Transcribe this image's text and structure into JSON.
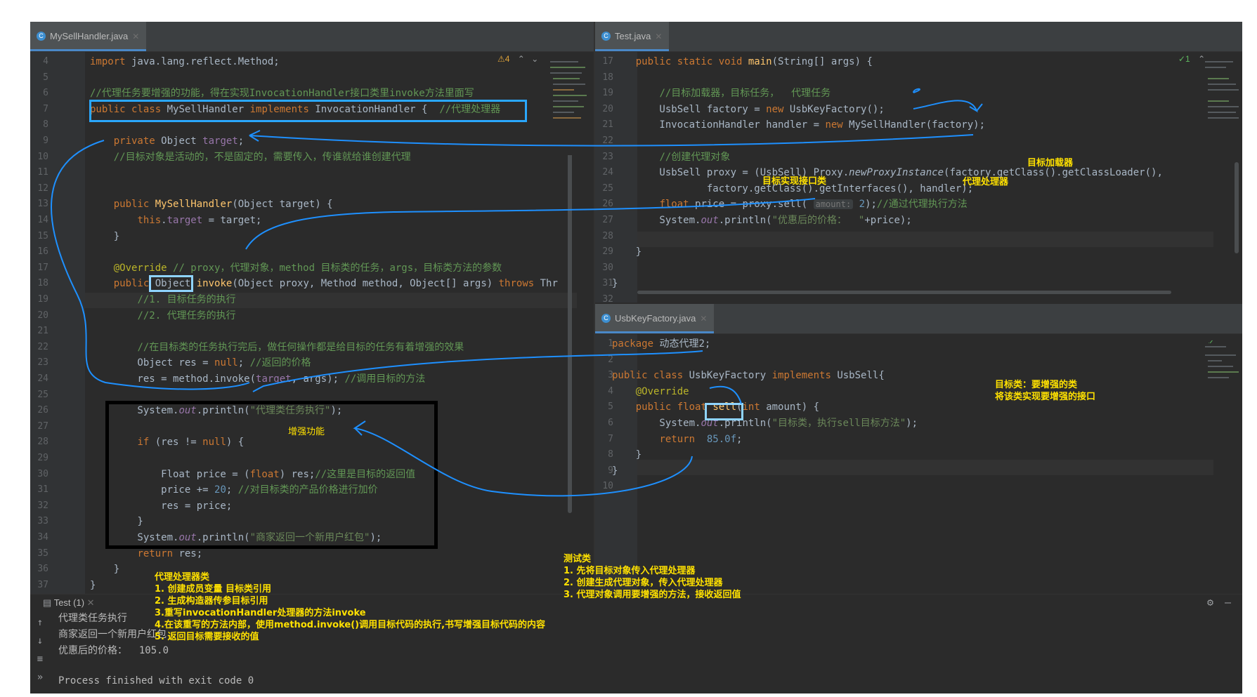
{
  "left_editor": {
    "tab_title": "MySellHandler.java",
    "inspection_badge": "⚠4",
    "lines": [
      {
        "n": "4",
        "html": "<span class=\"kw\">import</span> java.lang.reflect.Method;"
      },
      {
        "n": "5",
        "html": ""
      },
      {
        "n": "6",
        "html": "<span class=\"cm\">//代理任务要增强的功能，得在实现InvocationHandler接口类里invoke方法里面写</span>"
      },
      {
        "n": "7",
        "html": "<span class=\"kw\">public class</span> MySellHandler <span class=\"kw\">implements</span> InvocationHandler {  <span class=\"cm\">//代理处理器</span>"
      },
      {
        "n": "8",
        "html": ""
      },
      {
        "n": "9",
        "html": "    <span class=\"kw\">private</span> Object <span class=\"fld\">target</span>;"
      },
      {
        "n": "10",
        "html": "    <span class=\"cm\">//目标对象是活动的，不是固定的，需要传入，传谁就给谁创建代理</span>"
      },
      {
        "n": "11",
        "html": ""
      },
      {
        "n": "12",
        "html": ""
      },
      {
        "n": "13",
        "html": "    <span class=\"kw\">public</span> <span class=\"fn\">MySellHandler</span>(Object target) {"
      },
      {
        "n": "14",
        "html": "        <span class=\"kw\">this</span>.<span class=\"fld\">target</span> = target;"
      },
      {
        "n": "15",
        "html": "    }"
      },
      {
        "n": "16",
        "html": ""
      },
      {
        "n": "17",
        "html": "    <span class=\"ann\">@Override</span> <span class=\"cm\">// proxy，代理对象，method 目标类的任务，args，目标类方法的参数</span>"
      },
      {
        "n": "18",
        "html": "    <span class=\"kw\">public</span> Object <span class=\"fn\">invoke</span>(Object proxy, Method method, Object[] args) <span class=\"kw\">throws</span> Thr"
      },
      {
        "n": "19",
        "html": "        <span class=\"cm\">//1. 目标任务的执行</span>"
      },
      {
        "n": "20",
        "html": "        <span class=\"cm\">//2. 代理任务的执行</span>"
      },
      {
        "n": "21",
        "html": ""
      },
      {
        "n": "22",
        "html": "        <span class=\"cm\">//在目标类的任务执行完后，做任何操作都是给目标的任务有着增强的效果</span>"
      },
      {
        "n": "23",
        "html": "        Object res = <span class=\"kw\">null</span>; <span class=\"cm\">//返回的价格</span>"
      },
      {
        "n": "24",
        "html": "        res = method.invoke(<span class=\"fld\">target</span>, args); <span class=\"cm\">//调用目标的方法</span>"
      },
      {
        "n": "25",
        "html": ""
      },
      {
        "n": "26",
        "html": "        System.<span class=\"fld ital\">out</span>.println(<span class=\"str\">\"代理类任务执行\"</span>);"
      },
      {
        "n": "27",
        "html": ""
      },
      {
        "n": "28",
        "html": "        <span class=\"kw\">if</span> (res != <span class=\"kw\">null</span>) {"
      },
      {
        "n": "29",
        "html": ""
      },
      {
        "n": "30",
        "html": "            Float price = (<span class=\"kw\">float</span>) res;<span class=\"cm\">//这里是目标的返回值</span>"
      },
      {
        "n": "31",
        "html": "            price += <span class=\"num\">20</span>; <span class=\"cm\">//对目标类的产品价格进行加价</span>"
      },
      {
        "n": "32",
        "html": "            res = price;"
      },
      {
        "n": "33",
        "html": "        }"
      },
      {
        "n": "34",
        "html": "        System.<span class=\"fld ital\">out</span>.println(<span class=\"str\">\"商家返回一个新用户红包\"</span>);"
      },
      {
        "n": "35",
        "html": "        <span class=\"kw\">return</span> res;"
      },
      {
        "n": "36",
        "html": "    }"
      },
      {
        "n": "37",
        "html": "}"
      }
    ]
  },
  "test_editor": {
    "tab_title": "Test.java",
    "inspection_badge": "✓1",
    "lines": [
      {
        "n": "17",
        "html": "    <span class=\"kw\">public static void</span> <span class=\"fn\">main</span>(String[] args) {"
      },
      {
        "n": "18",
        "html": ""
      },
      {
        "n": "19",
        "html": "        <span class=\"cm\">//目标加载器，目标任务，  代理任务</span>"
      },
      {
        "n": "20",
        "html": "        UsbSell factory = <span class=\"kw\">new</span> UsbKeyFactory();"
      },
      {
        "n": "21",
        "html": "        InvocationHandler handler = <span class=\"kw\">new</span> MySellHandler(factory);"
      },
      {
        "n": "22",
        "html": ""
      },
      {
        "n": "23",
        "html": "        <span class=\"cm\">//创建代理对象</span>"
      },
      {
        "n": "24",
        "html": "        UsbSell proxy = (UsbSell) Proxy.<span class=\"ital\">newProxyInstance</span>(factory.getClass().getClassLoader(),"
      },
      {
        "n": "25",
        "html": "                factory.getClass().getInterfaces(), handler);"
      },
      {
        "n": "26",
        "html": "        <span class=\"kw\">float</span> price = proxy.sell( <span class=\"inlay\">amount:</span> <span class=\"num\">2</span>);<span class=\"cm\">//通过代理执行方法</span>"
      },
      {
        "n": "27",
        "html": "        System.<span class=\"fld ital\">out</span>.println(<span class=\"str\">\"优惠后的价格：  \"</span>+price);"
      },
      {
        "n": "28",
        "html": ""
      },
      {
        "n": "29",
        "html": "    }"
      },
      {
        "n": "30",
        "html": ""
      },
      {
        "n": "31",
        "html": "}"
      },
      {
        "n": "32",
        "html": ""
      }
    ]
  },
  "factory_editor": {
    "tab_title": "UsbKeyFactory.java",
    "lines": [
      {
        "n": "1",
        "html": "<span class=\"kw\">package</span> 动态代理2;"
      },
      {
        "n": "2",
        "html": ""
      },
      {
        "n": "3",
        "html": "<span class=\"kw\">public class</span> UsbKeyFactory <span class=\"kw\">implements</span> UsbSell{"
      },
      {
        "n": "4",
        "html": "    <span class=\"ann\">@Override</span>"
      },
      {
        "n": "5",
        "html": "    <span class=\"kw\">public float</span> <span class=\"fn\">sell</span>(<span class=\"kw\">int</span> amount) {"
      },
      {
        "n": "6",
        "html": "        System.<span class=\"fld ital\">out</span>.println(<span class=\"str\">\"目标类，执行sell目标方法\"</span>);"
      },
      {
        "n": "7",
        "html": "        <span class=\"kw\">return</span>  <span class=\"num\">85.0f</span>;"
      },
      {
        "n": "8",
        "html": "    }"
      },
      {
        "n": "9",
        "html": "}"
      },
      {
        "n": "10",
        "html": ""
      }
    ]
  },
  "run_panel": {
    "tab_title": "Test (1)",
    "output_lines": [
      "代理类任务执行",
      "商家返回一个新用户红包",
      "优惠后的价格：  105.0",
      "",
      "Process finished with exit code 0"
    ]
  },
  "annotations": {
    "enhance_label": "增强功能",
    "target_loader": "目标加载器",
    "target_interface": "目标实现接口类",
    "proxy_handler": "代理处理器",
    "target_class": "目标类：要增强的类\n将该类实现要增强的接口",
    "test_class": "测试类\n1. 先将目标对象传入代理处理器\n2. 创建生成代理对象，传入代理处理器\n3. 代理对象调用要增强的方法，接收返回值",
    "handler_class": "代理处理器类\n1. 创建成员变量 目标类引用\n2. 生成构造器传参目标引用\n3.重写invocationHandler处理器的方法invoke\n4.在该重写的方法内部，使用method.invoke()调用目标代码的执行,书写增强目标代码的内容\n5. 返回目标需要接收的值"
  },
  "colors": {
    "annotation_text": "#ffe100",
    "highlight_box": "#2aa7ff",
    "arrow": "#1e90ff"
  }
}
